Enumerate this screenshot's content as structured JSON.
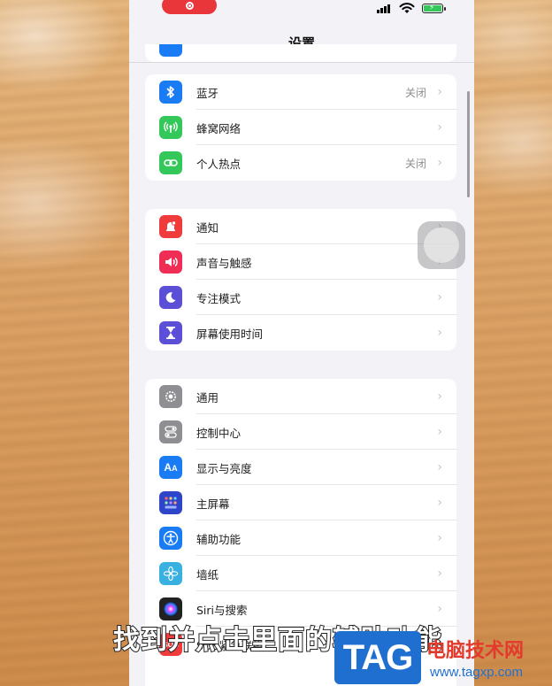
{
  "nav": {
    "title": "设置"
  },
  "groups": [
    {
      "items": [
        {
          "label": "蓝牙",
          "value": "关闭",
          "icon": "bluetooth-icon",
          "color": "#1a7cf5"
        },
        {
          "label": "蜂窝网络",
          "value": "",
          "icon": "cellular-antenna-icon",
          "color": "#34c759"
        },
        {
          "label": "个人热点",
          "value": "关闭",
          "icon": "hotspot-link-icon",
          "color": "#34c759"
        }
      ]
    },
    {
      "items": [
        {
          "label": "通知",
          "value": "",
          "icon": "notification-bell-icon",
          "color": "#ef3b3b"
        },
        {
          "label": "声音与触感",
          "value": "",
          "icon": "speaker-icon",
          "color": "#ef2d55"
        },
        {
          "label": "专注模式",
          "value": "",
          "icon": "moon-icon",
          "color": "#5a4fd6"
        },
        {
          "label": "屏幕使用时间",
          "value": "",
          "icon": "hourglass-icon",
          "color": "#5a4fd6"
        }
      ]
    },
    {
      "items": [
        {
          "label": "通用",
          "value": "",
          "icon": "gear-icon",
          "color": "#8e8e93"
        },
        {
          "label": "控制中心",
          "value": "",
          "icon": "toggles-icon",
          "color": "#8e8e93"
        },
        {
          "label": "显示与亮度",
          "value": "",
          "icon": "text-size-icon",
          "color": "#1a7cf5"
        },
        {
          "label": "主屏幕",
          "value": "",
          "icon": "home-grid-icon",
          "color": "#2f45c9"
        },
        {
          "label": "辅助功能",
          "value": "",
          "icon": "accessibility-icon",
          "color": "#1a7cf5"
        },
        {
          "label": "墙纸",
          "value": "",
          "icon": "flower-icon",
          "color": "#38b0e0"
        },
        {
          "label": "Siri与搜索",
          "value": "",
          "icon": "siri-icon",
          "color": "#222222"
        },
        {
          "label": "SOS紧急联络",
          "value": "",
          "icon": "sos-icon",
          "color": "#ef3b3b",
          "icon_text": "SOS"
        }
      ]
    }
  ],
  "caption": "找到并点击里面的辅助功能",
  "watermark": {
    "tag": "TAG",
    "name": "电脑技术网",
    "url": "www.tagxp.com"
  }
}
